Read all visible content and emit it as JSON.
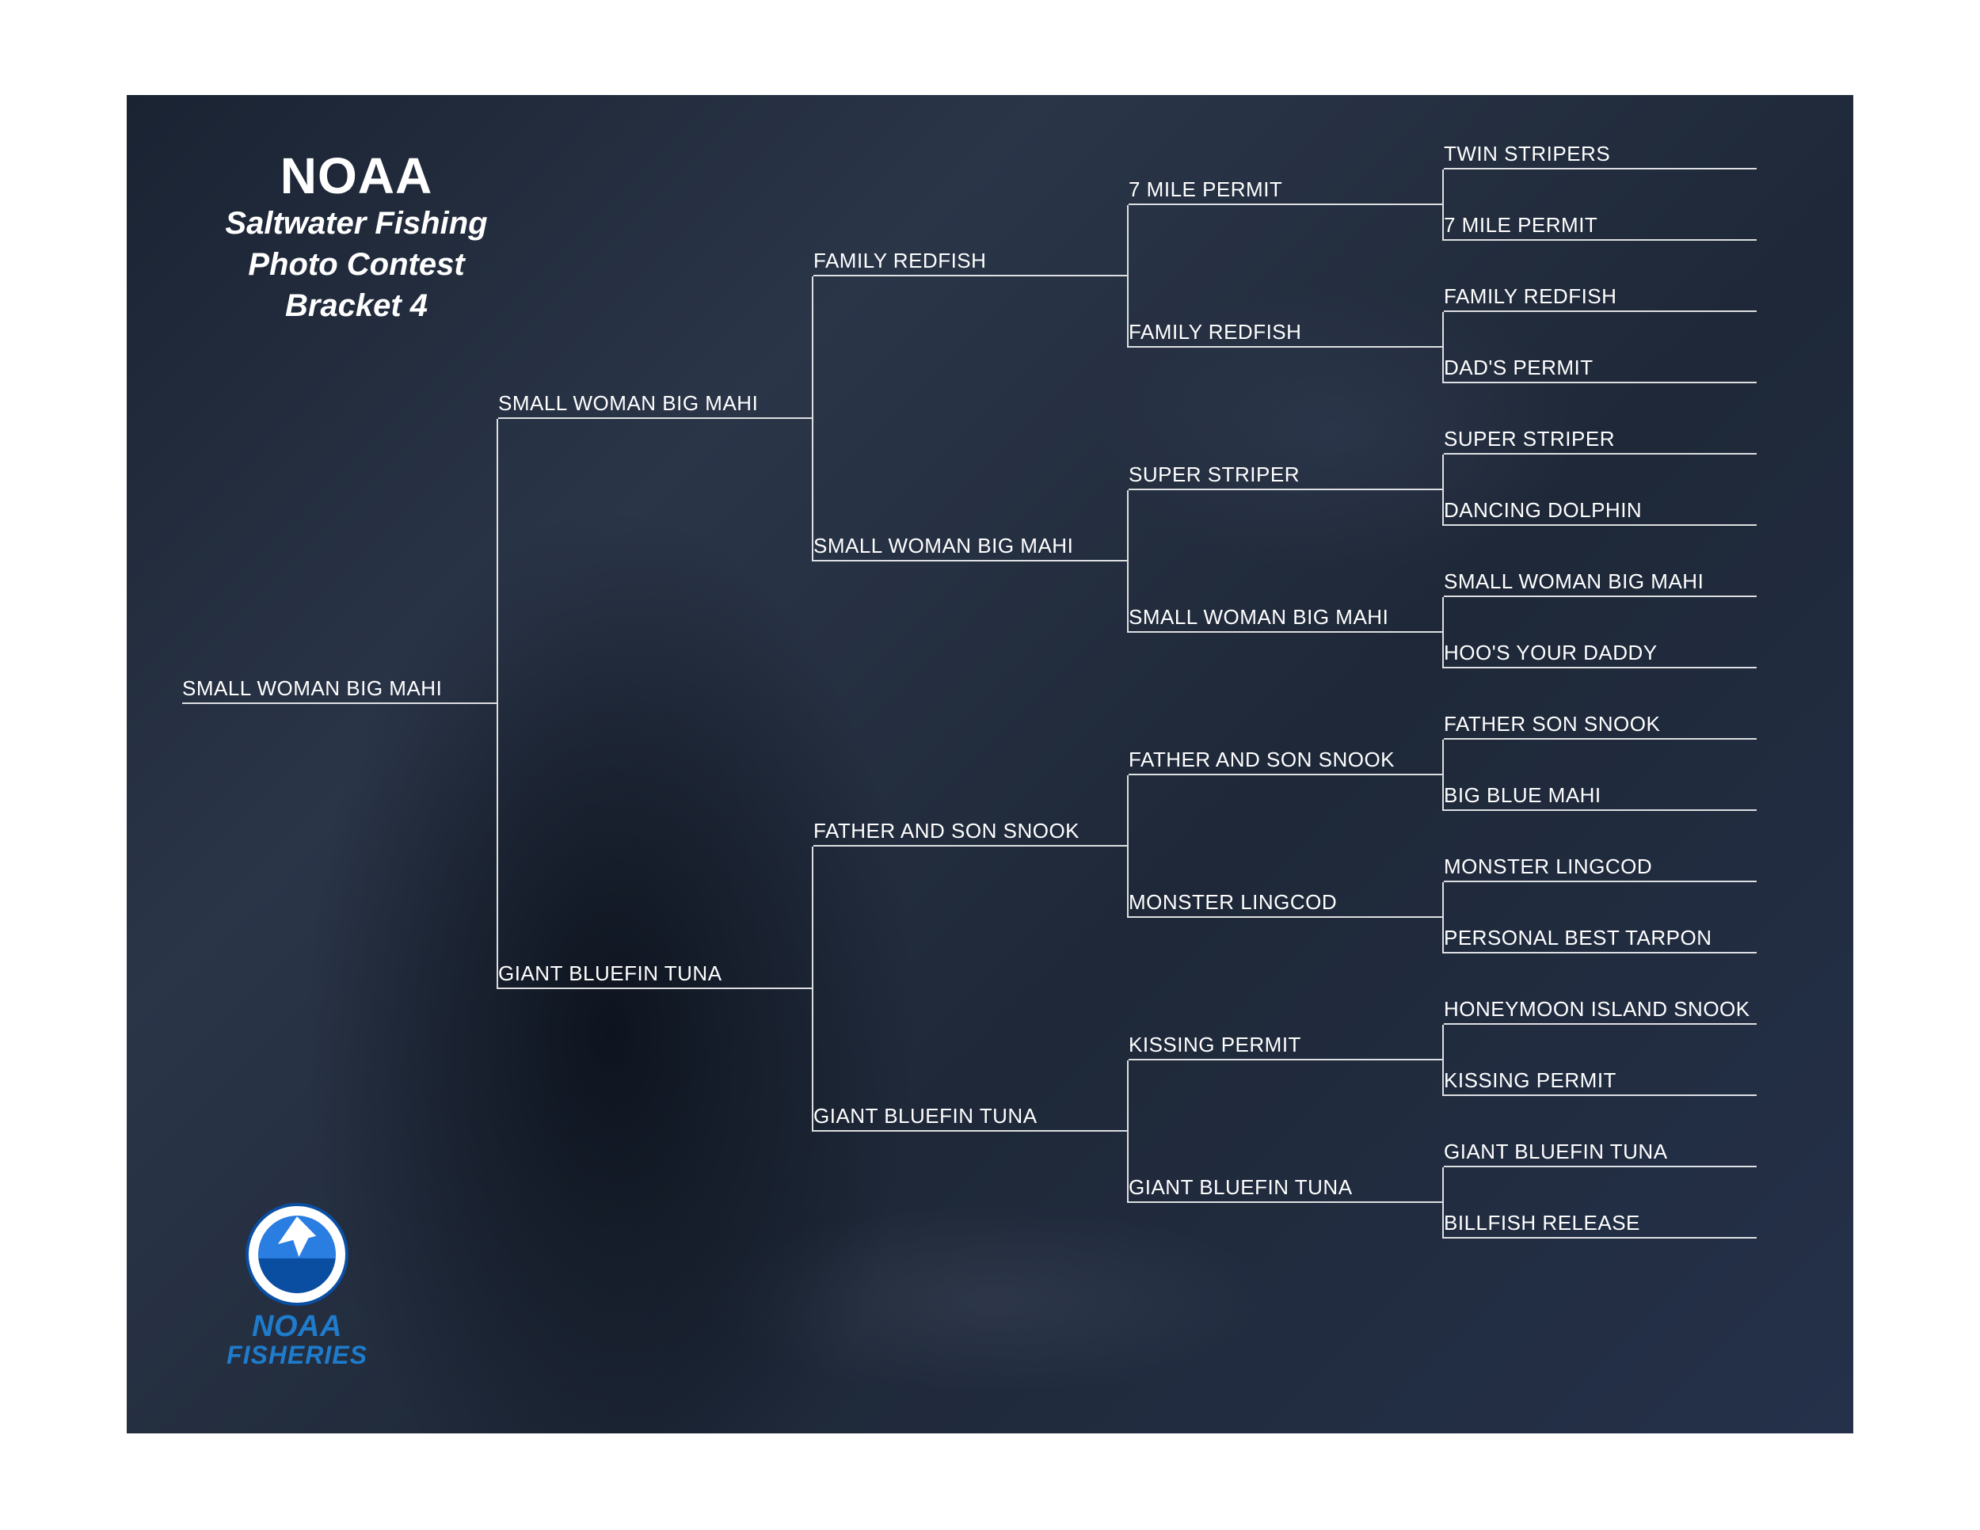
{
  "title": {
    "org": "NOAA",
    "line1": "Saltwater Fishing",
    "line2": "Photo Contest",
    "line3": "Bracket 4"
  },
  "logo": {
    "noaa": "NOAA",
    "fisheries": "FISHERIES"
  },
  "round16": [
    "TWIN STRIPERS",
    "7 MILE PERMIT",
    "FAMILY REDFISH",
    "DAD'S PERMIT",
    "SUPER STRIPER",
    "DANCING DOLPHIN",
    "SMALL WOMAN BIG MAHI",
    "HOO'S YOUR DADDY",
    "FATHER SON SNOOK",
    "BIG BLUE MAHI",
    "MONSTER LINGCOD",
    "PERSONAL BEST TARPON",
    "HONEYMOON ISLAND SNOOK",
    "KISSING PERMIT",
    "GIANT BLUEFIN TUNA",
    "BILLFISH RELEASE"
  ],
  "round8": [
    "7 MILE PERMIT",
    "FAMILY REDFISH",
    "SUPER STRIPER",
    "SMALL WOMAN BIG MAHI",
    "FATHER AND SON SNOOK",
    "MONSTER LINGCOD",
    "KISSING PERMIT",
    "GIANT BLUEFIN TUNA"
  ],
  "round4": [
    "FAMILY REDFISH",
    "SMALL WOMAN BIG MAHI",
    "FATHER AND SON SNOOK",
    "GIANT BLUEFIN TUNA"
  ],
  "round2": [
    "SMALL WOMAN BIG MAHI",
    "GIANT BLUEFIN TUNA"
  ],
  "winner": "SMALL WOMAN BIG MAHI"
}
